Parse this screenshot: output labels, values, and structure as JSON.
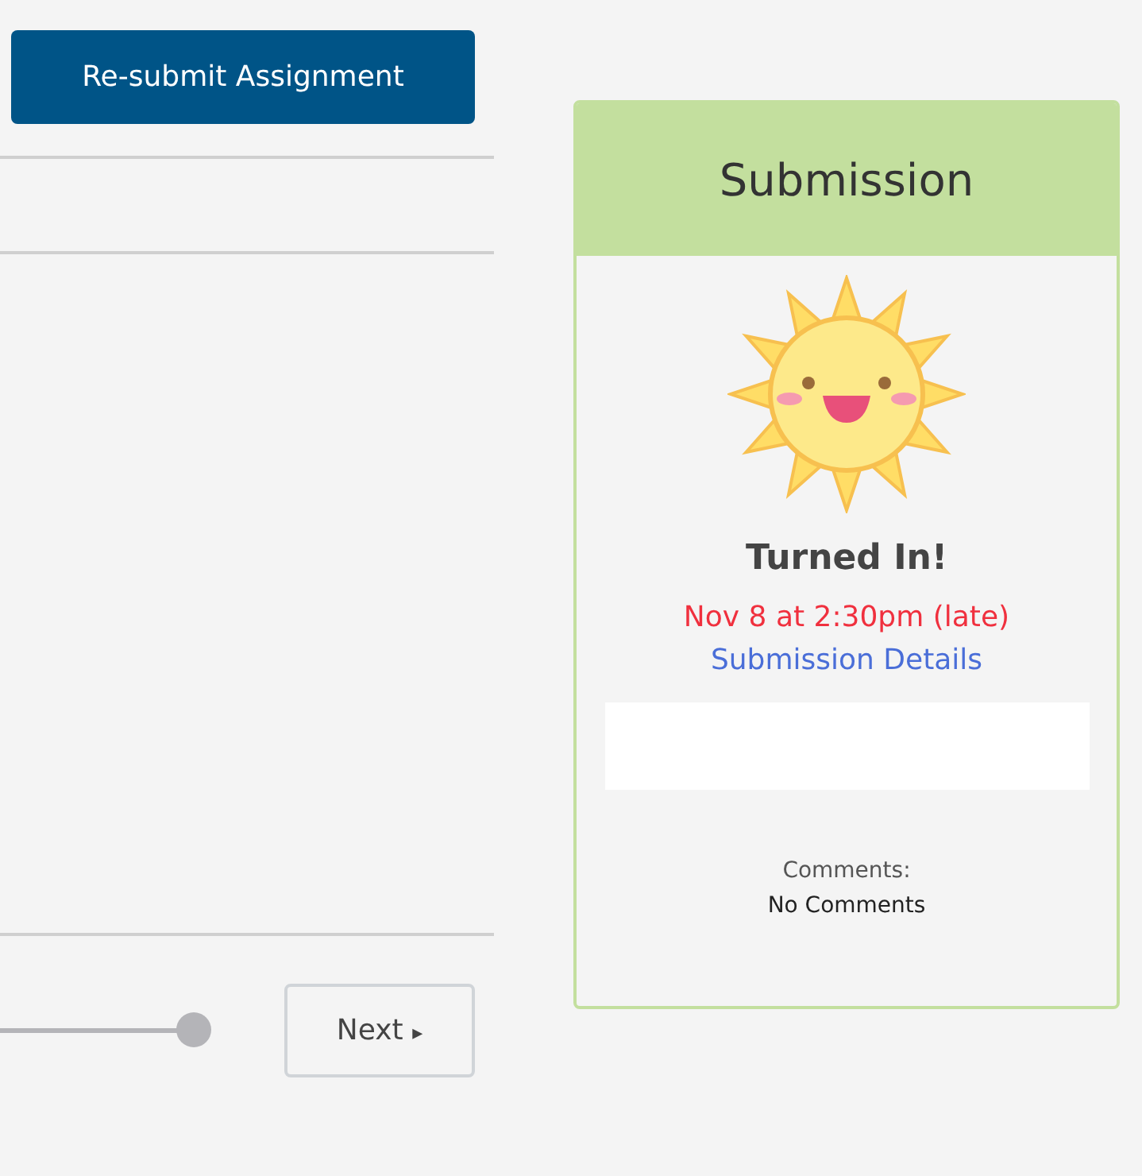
{
  "resubmit_button": {
    "label": "Re-submit Assignment"
  },
  "progress_slider": {
    "level": 1
  },
  "next_button": {
    "label": "Next",
    "arrow": "▸"
  },
  "submission_card": {
    "title": "Submission",
    "status": "Turned In!",
    "date": "Nov 8 at 2:30pm (late)",
    "late": true,
    "details_link": "Submission Details",
    "comments_label": "Comments:",
    "comments": "No Comments"
  }
}
